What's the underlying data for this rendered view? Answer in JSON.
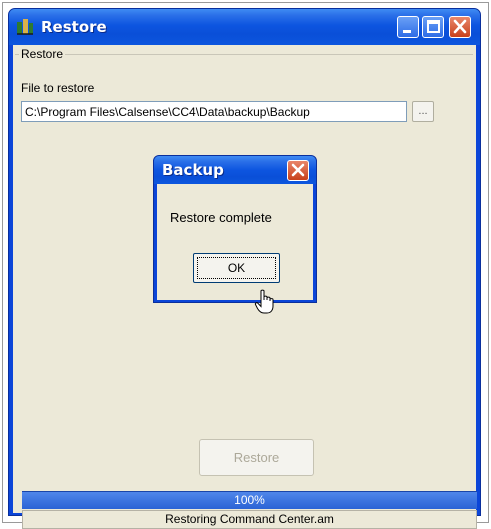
{
  "window": {
    "title": "Restore",
    "icon": "calsense-app-icon"
  },
  "titlebar_buttons": {
    "minimize_icon": "minimize-icon",
    "maximize_icon": "maximize-icon",
    "close_icon": "close-icon"
  },
  "group": {
    "label": "Restore"
  },
  "file": {
    "label": "File to restore",
    "value": "C:\\Program Files\\Calsense\\CC4\\Data\\backup\\Backup",
    "browse_label": "..."
  },
  "dialog": {
    "title": "Backup",
    "message": "Restore complete",
    "ok_label": "OK"
  },
  "restore_button": {
    "label": "Restore",
    "enabled": false
  },
  "progress": {
    "value": 1.0,
    "text": "100%"
  },
  "status": {
    "text": "Restoring Command Center.am"
  },
  "colors": {
    "title_blue": "#0b45d8",
    "client_bg": "#ece9d8",
    "progress_blue": "#2a63d5",
    "close_red": "#c8411c"
  }
}
